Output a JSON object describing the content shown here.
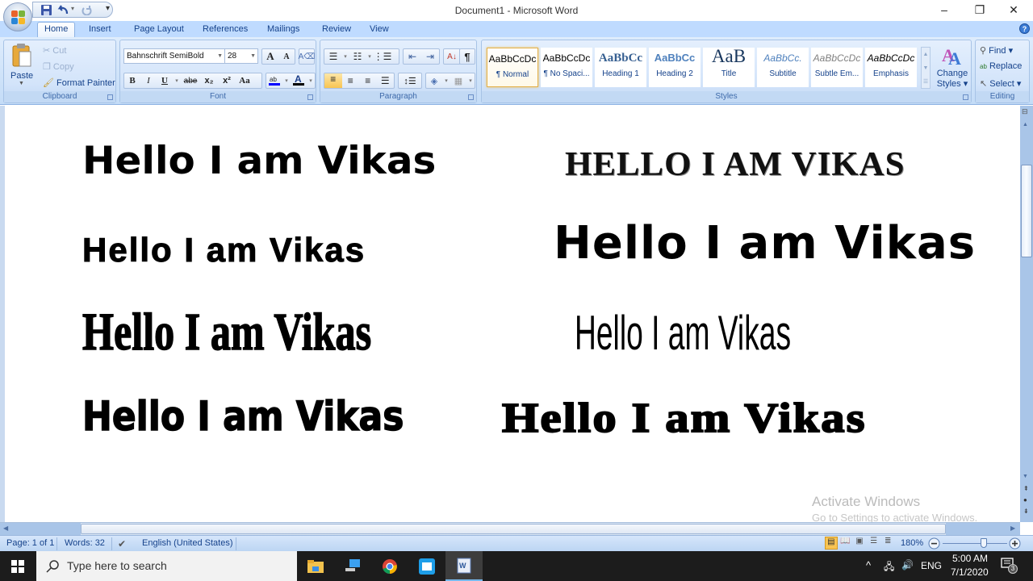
{
  "window": {
    "title": "Document1 - Microsoft Word",
    "minimize": "–",
    "restore": "❐",
    "close": "✕"
  },
  "qat": {
    "customize_arrow": "▾"
  },
  "tabs": [
    {
      "label": "Home",
      "active": true
    },
    {
      "label": "Insert"
    },
    {
      "label": "Page Layout"
    },
    {
      "label": "References"
    },
    {
      "label": "Mailings"
    },
    {
      "label": "Review"
    },
    {
      "label": "View"
    }
  ],
  "clipboard": {
    "paste": "Paste",
    "cut": "Cut",
    "copy": "Copy",
    "format_painter": "Format Painter",
    "label": "Clipboard"
  },
  "font": {
    "name": "Bahnschrift SemiBold",
    "size": "28",
    "grow": "A",
    "shrink": "A",
    "bold": "B",
    "italic": "I",
    "underline": "U",
    "strike": "abe",
    "subscript": "x₂",
    "superscript": "x²",
    "change_case": "Aa",
    "label": "Font",
    "highlight_color": "#0000ff",
    "font_color": "#000000"
  },
  "paragraph": {
    "label": "Paragraph",
    "pilcrow": "¶"
  },
  "styles": {
    "items": [
      {
        "preview": "AaBbCcDc",
        "name": "¶ Normal",
        "selected": true
      },
      {
        "preview": "AaBbCcDc",
        "name": "¶ No Spaci..."
      },
      {
        "preview": "AaBbCc",
        "name": "Heading 1"
      },
      {
        "preview": "AaBbCc",
        "name": "Heading 2"
      },
      {
        "preview": "AaB",
        "name": "Title"
      },
      {
        "preview": "AaBbCc.",
        "name": "Subtitle"
      },
      {
        "preview": "AaBbCcDc",
        "name": "Subtle Em..."
      },
      {
        "preview": "AaBbCcDc",
        "name": "Emphasis"
      }
    ],
    "change_styles_line1": "Change",
    "change_styles_line2": "Styles ▾",
    "label": "Styles"
  },
  "editing": {
    "find": "Find ▾",
    "replace": "Replace",
    "select": "Select ▾",
    "label": "Editing"
  },
  "document": {
    "samples": [
      {
        "text": "Hello I am Vikas"
      },
      {
        "text": "HELLO I AM VIKAS"
      },
      {
        "text": "Hello I am Vikas"
      },
      {
        "text": "Hello I am Vikas"
      },
      {
        "text": "Hello I am Vikas"
      },
      {
        "text": "Hello I am Vikas"
      },
      {
        "text": "Hello I am Vikas"
      },
      {
        "text": "Hello I am Vikas"
      }
    ]
  },
  "watermark": {
    "line1": "Activate Windows",
    "line2": "Go to Settings to activate Windows."
  },
  "status": {
    "page": "Page: 1 of 1",
    "words": "Words: 32",
    "language": "English (United States)",
    "zoom": "180%",
    "zoom_percent": 180
  },
  "taskbar": {
    "search_placeholder": "Type here to search",
    "lang": "ENG",
    "time": "5:00 AM",
    "date": "7/1/2020",
    "notifications": "3"
  }
}
